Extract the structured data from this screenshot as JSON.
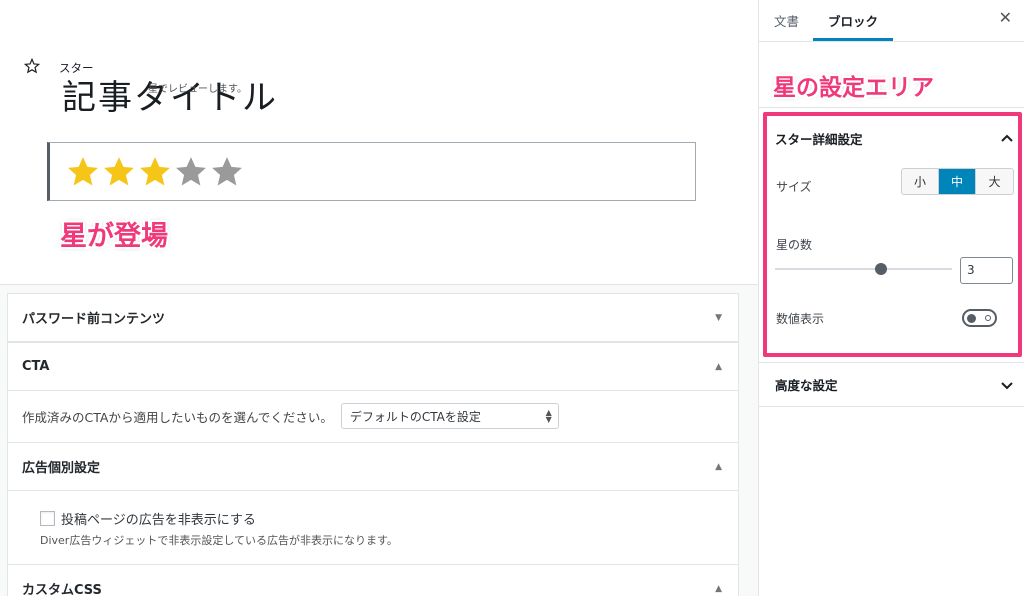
{
  "editor": {
    "post_title": "記事タイトル",
    "rating": {
      "value": 3,
      "max": 5
    },
    "star_colors": {
      "filled": "#f5c518",
      "empty": "#9a9a9a"
    },
    "callout_left": "星が登場"
  },
  "meta_boxes": {
    "password": {
      "title": "パスワード前コンテンツ",
      "indicator": "▼"
    },
    "cta": {
      "title": "CTA",
      "indicator": "▲",
      "prompt": "作成済みのCTAから適用したいものを選んでください。",
      "select_value": "デフォルトのCTAを設定"
    },
    "ads": {
      "title": "広告個別設定",
      "indicator": "▲",
      "checkbox_label": "投稿ページの広告を非表示にする",
      "note": "Diver広告ウィジェットで非表示設定している広告が非表示になります。"
    },
    "css": {
      "title": "カスタムCSS",
      "indicator": "▲"
    }
  },
  "sidebar": {
    "tabs": [
      {
        "label": "文書",
        "active": false
      },
      {
        "label": "ブロック",
        "active": true
      }
    ],
    "close_label": "✕",
    "block": {
      "name": "スター",
      "description": "星でレビューします。"
    },
    "callout_right": "星の設定エリア",
    "star_settings": {
      "title": "スター詳細設定",
      "size_label": "サイズ",
      "size_options": [
        "小",
        "中",
        "大"
      ],
      "size_selected": "中",
      "count_label": "星の数",
      "count_value": "3",
      "count_slider_fraction": 0.6,
      "numeric_label": "数値表示",
      "numeric_enabled": false
    },
    "advanced": {
      "title": "高度な設定"
    }
  },
  "colors": {
    "accent": "#0085ba",
    "highlight": "#f0397a"
  }
}
